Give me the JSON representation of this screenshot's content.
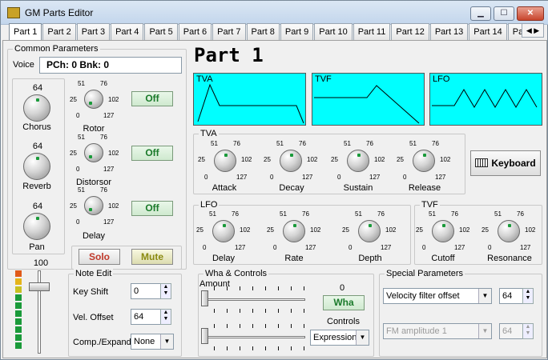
{
  "window": {
    "title": "GM Parts Editor"
  },
  "window_buttons": {
    "minimize": "▁",
    "maximize": "☐",
    "close": "✕"
  },
  "tabs": [
    {
      "label": "Part 1",
      "active": true
    },
    {
      "label": "Part 2"
    },
    {
      "label": "Part 3"
    },
    {
      "label": "Part 4"
    },
    {
      "label": "Part 5"
    },
    {
      "label": "Part 6"
    },
    {
      "label": "Part 7"
    },
    {
      "label": "Part 8"
    },
    {
      "label": "Part 9"
    },
    {
      "label": "Part 10"
    },
    {
      "label": "Part 11"
    },
    {
      "label": "Part 12"
    },
    {
      "label": "Part 13"
    },
    {
      "label": "Part 14"
    },
    {
      "label": "Par"
    }
  ],
  "tab_scroll": {
    "left": "◀",
    "right": "▶"
  },
  "common": {
    "title": "Common Parameters",
    "voice_label": "Voice",
    "voice_value": "PCh: 0 Bnk: 0",
    "chorus": {
      "value": "64",
      "label": "Chorus"
    },
    "reverb": {
      "value": "64",
      "label": "Reverb"
    },
    "pan": {
      "value": "64",
      "label": "Pan"
    },
    "rotor": {
      "label": "Rotor",
      "button": "Off"
    },
    "distorsor": {
      "label": "Distorsor",
      "button": "Off"
    },
    "delay": {
      "label": "Delay",
      "button": "Off"
    },
    "solo": "Solo",
    "mute": "Mute",
    "volume_value": "100"
  },
  "scale": {
    "s0": "0",
    "s25": "25",
    "s51": "51",
    "s76": "76",
    "s102": "102",
    "s127": "127"
  },
  "part_title": "Part 1",
  "displays": {
    "tva": "TVA",
    "tvf": "TVF",
    "lfo": "LFO"
  },
  "tva": {
    "title": "TVA",
    "attack": "Attack",
    "decay": "Decay",
    "sustain": "Sustain",
    "release": "Release"
  },
  "keyboard_button": "Keyboard",
  "lfo": {
    "title": "LFO",
    "delay": "Delay",
    "rate": "Rate",
    "depth": "Depth"
  },
  "tvf": {
    "title": "TVF",
    "cutoff": "Cutoff",
    "resonance": "Resonance"
  },
  "note_edit": {
    "title": "Note Edit",
    "key_shift_label": "Key Shift",
    "key_shift_value": "0",
    "vel_offset_label": "Vel. Offset",
    "vel_offset_value": "64",
    "comp_label": "Comp./Expand",
    "comp_value": "None"
  },
  "wha": {
    "title": "Wha & Controls",
    "amount_label": "Amount",
    "value": "0",
    "button": "Wha",
    "controls_label": "Controls",
    "controls_value": "Expression"
  },
  "special": {
    "title": "Special Parameters",
    "param1": "Velocity filter offset",
    "param1_value": "64",
    "param2": "FM amplitude 1",
    "param2_value": "64"
  },
  "colors": {
    "accent": "#00ffff",
    "led_green": "#1a9a3a",
    "button_text": "#1a7a2a",
    "solo": "#c0392b",
    "mute": "#8a8a10"
  }
}
